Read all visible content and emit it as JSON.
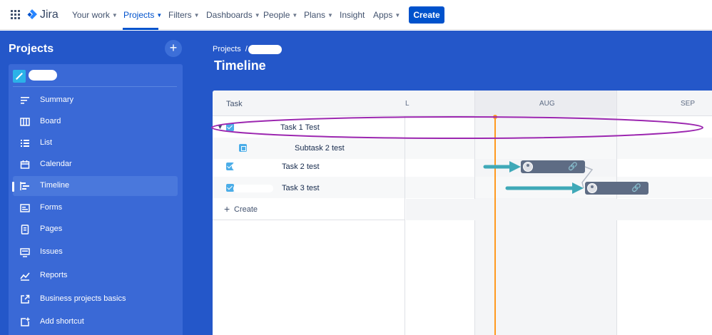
{
  "topnav": {
    "logo_text": "Jira",
    "items": [
      {
        "label": "Your work"
      },
      {
        "label": "Projects"
      },
      {
        "label": "Filters"
      },
      {
        "label": "Dashboards"
      },
      {
        "label": "People"
      },
      {
        "label": "Plans"
      },
      {
        "label": "Insight"
      },
      {
        "label": "Apps"
      }
    ],
    "create_label": "Create",
    "active_item": "Projects"
  },
  "sidebar": {
    "title": "Projects",
    "items": [
      {
        "label": "Summary",
        "icon": "summary-icon"
      },
      {
        "label": "Board",
        "icon": "board-icon"
      },
      {
        "label": "List",
        "icon": "list-icon"
      },
      {
        "label": "Calendar",
        "icon": "calendar-icon"
      },
      {
        "label": "Timeline",
        "icon": "timeline-icon",
        "selected": true
      },
      {
        "label": "Forms",
        "icon": "forms-icon"
      },
      {
        "label": "Pages",
        "icon": "pages-icon"
      },
      {
        "label": "Issues",
        "icon": "issues-icon"
      },
      {
        "label": "Reports",
        "icon": "reports-icon"
      },
      {
        "label": "Business projects basics",
        "icon": "external-link-icon"
      },
      {
        "label": "Add shortcut",
        "icon": "add-shortcut-icon"
      }
    ]
  },
  "breadcrumb": {
    "root": "Projects",
    "separator": "/"
  },
  "page": {
    "title": "Timeline"
  },
  "timeline": {
    "task_header": "Task",
    "months": [
      "L",
      "AUG",
      "SEP"
    ],
    "rows": [
      {
        "label": "Task 1 Test",
        "type": "task"
      },
      {
        "label": "Subtask 2 test",
        "type": "subtask"
      },
      {
        "label": "Task 2 test",
        "type": "task"
      },
      {
        "label": "Task 3 test",
        "type": "task"
      }
    ],
    "create_label": "Create"
  },
  "colors": {
    "brand": "#0052cc",
    "sidebar_bg": "#2457c9",
    "today_marker": "#ff991f",
    "bar": "#5e6c84",
    "annotation_arrow": "#3fa9b8",
    "annotation_highlight": "#9c27b0"
  }
}
